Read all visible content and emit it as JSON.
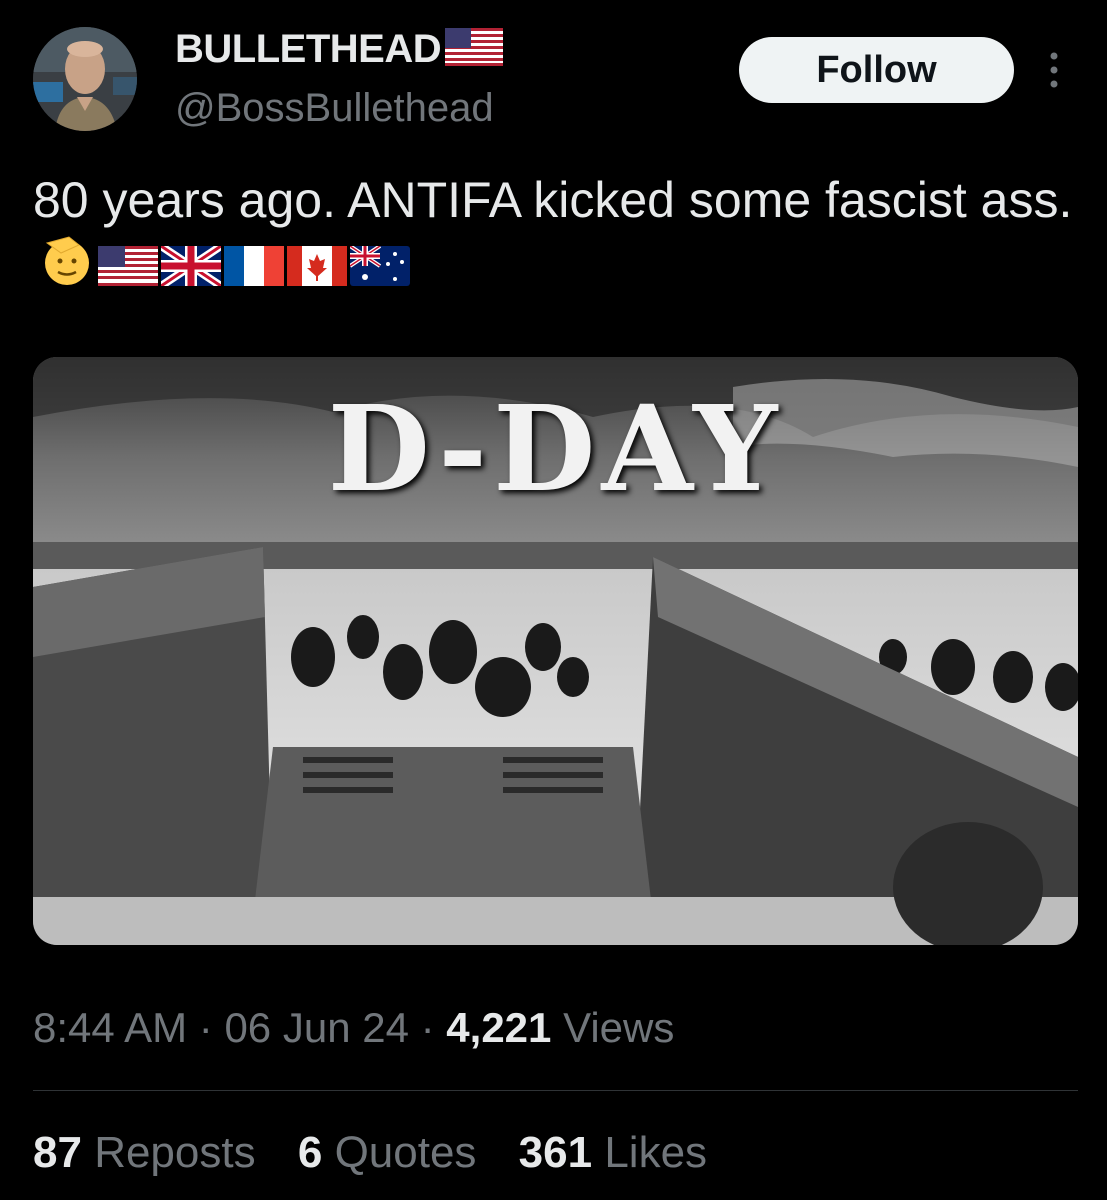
{
  "author": {
    "display_name": "BULLETHEAD",
    "handle": "@BossBullethead",
    "name_flag": "us-flag-icon"
  },
  "follow_label": "Follow",
  "tweet": {
    "text": "80 years ago. ANTIFA kicked some fascist ass.",
    "emojis": [
      "saluting-face-icon",
      "us-flag-icon",
      "uk-flag-icon",
      "france-flag-icon",
      "canada-flag-icon",
      "australia-flag-icon"
    ]
  },
  "media": {
    "title": "D-DAY"
  },
  "meta": {
    "time": "8:44 AM",
    "sep1": "·",
    "date": "06 Jun 24",
    "sep2": "·",
    "views_count": "4,221",
    "views_label": "Views"
  },
  "stats": {
    "reposts_count": "87",
    "reposts_label": "Reposts",
    "quotes_count": "6",
    "quotes_label": "Quotes",
    "likes_count": "361",
    "likes_label": "Likes"
  },
  "colors": {
    "background": "#000000",
    "text_primary": "#e7e9ea",
    "text_secondary": "#71767b",
    "follow_bg": "#eff3f4",
    "divider": "#2f3336"
  }
}
